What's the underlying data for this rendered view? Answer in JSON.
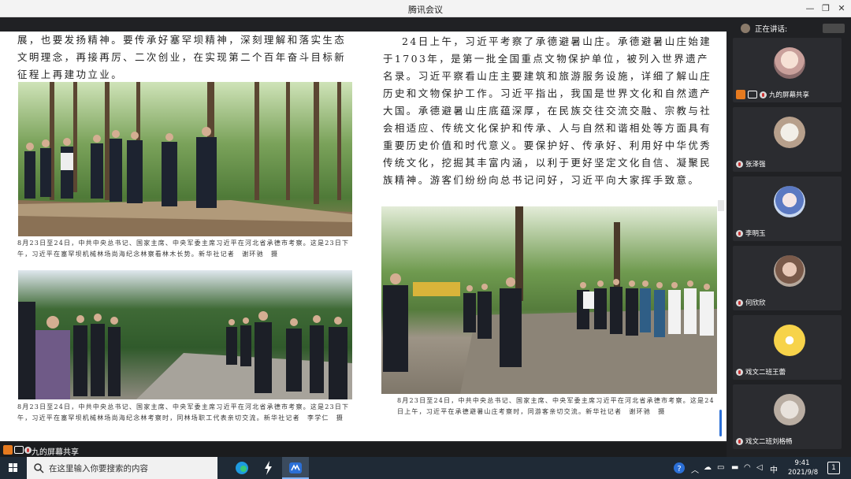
{
  "window": {
    "title": "腾讯会议",
    "minimize": "—",
    "restore": "❐",
    "close": "✕"
  },
  "document": {
    "left_intro": "展，也要发扬精神。要传承好塞罕坝精神，深刻理解和落实生态文明理念，再接再厉、二次创业，在实现第二个百年奋斗目标新征程上再建功立业。",
    "right_text": "24日上午，习近平考察了承德避暑山庄。承德避暑山庄始建于1703年，是第一批全国重点文物保护单位，被列入世界遗产名录。习近平察看山庄主要建筑和旅游服务设施，详细了解山庄历史和文物保护工作。习近平指出，我国是世界文化和自然遗产大国。承德避暑山庄底蕴深厚，在民族交往交流交融、宗教与社会相适应、传统文化保护和传承、人与自然和谐相处等方面具有重要历史价值和时代意义。要保护好、传承好、利用好中华优秀传统文化，挖掘其丰富内涵，以利于更好坚定文化自信、凝聚民族精神。游客们纷纷向总书记问好，习近平向大家挥手致意。",
    "caption1": "8月23日至24日，中共中央总书记、国家主席、中央军委主席习近平在河北省承德市考察。这是23日下午，习近平在塞罕坝机械林场尚海纪念林察看林木长势。新华社记者　谢环驰　摄",
    "caption2": "8月23日至24日，中共中央总书记、国家主席、中央军委主席习近平在河北省承德市考察。这是23日下午，习近平在塞罕坝机械林场尚海纪念林考察时，同林场职工代表亲切交流。新华社记者　李学仁　摄",
    "caption3": "8月23日至24日，中共中央总书记、国家主席、中央军委主席习近平在河北省承德市考察。这是24日上午，习近平在承德避暑山庄考察时，同游客亲切交流。新华社记者　谢环驰　摄"
  },
  "panel": {
    "speaking_label": "正在讲话:",
    "participants": [
      {
        "name": "九的屏幕共享",
        "avatar": "anime-girl-avatar",
        "sharing": true
      },
      {
        "name": "张泽强",
        "avatar": "dog-avatar",
        "sharing": false
      },
      {
        "name": "李明玉",
        "avatar": "anime-avatar",
        "sharing": false
      },
      {
        "name": "何欣欣",
        "avatar": "portrait-avatar",
        "sharing": false
      },
      {
        "name": "戏文二班王蕾",
        "avatar": "cartoon-avatar",
        "sharing": false
      },
      {
        "name": "戏文二班刘格畅",
        "avatar": "cat-avatar",
        "sharing": false
      }
    ]
  },
  "sharebar": {
    "label": "九的屏幕共享"
  },
  "taskbar": {
    "search_placeholder": "在这里输入你要搜索的内容",
    "time": "9:41",
    "date": "2021/9/8",
    "ime": "中",
    "notification_count": "1"
  },
  "colors": {
    "accent": "#2b6fd6",
    "tile_bg": "#2b2c30",
    "taskbar": "#1f2a36"
  }
}
